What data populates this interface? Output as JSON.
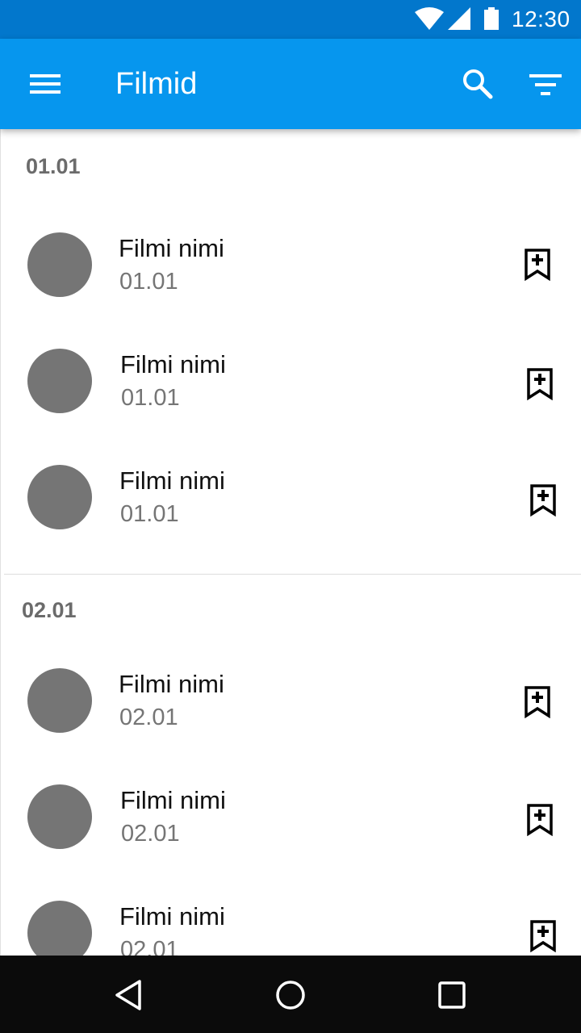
{
  "status_bar": {
    "time": "12:30",
    "icons": [
      "wifi-icon",
      "cell-signal-icon",
      "battery-icon"
    ]
  },
  "app_bar": {
    "title": "Filmid",
    "icons": [
      "menu-icon",
      "search-icon",
      "filter-icon"
    ],
    "color": "#0696ee"
  },
  "sections": [
    {
      "header": "01.01",
      "items": [
        {
          "title": "Filmi nimi",
          "subtitle": "01.01"
        },
        {
          "title": "Filmi nimi",
          "subtitle": "01.01"
        },
        {
          "title": "Filmi nimi",
          "subtitle": "01.01"
        }
      ]
    },
    {
      "header": "02.01",
      "items": [
        {
          "title": "Filmi nimi",
          "subtitle": "02.01"
        },
        {
          "title": "Filmi nimi",
          "subtitle": "02.01"
        },
        {
          "title": "Filmi nimi",
          "subtitle": "02.01"
        }
      ]
    }
  ],
  "item_action_icon": "bookmark-add-icon",
  "nav_bar": {
    "icons": [
      "back-icon",
      "home-icon",
      "recent-apps-icon"
    ]
  }
}
